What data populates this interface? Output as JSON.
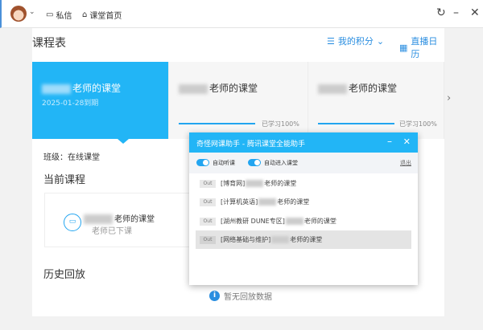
{
  "topbar": {
    "messages": "私信",
    "home": "课堂首页",
    "icons": [
      "avatar",
      "chevron-down-icon",
      "message-icon",
      "home-icon",
      "refresh-icon",
      "minimize-icon",
      "close-icon"
    ]
  },
  "main": {
    "title": "课程表",
    "points": "我的积分",
    "calendar": "直播日历",
    "cards": [
      {
        "name": "老师的课堂",
        "date": "2025-01-28到期",
        "active": true
      },
      {
        "name": "老师的课堂",
        "progress_label": "已学习100%",
        "progress": 100
      },
      {
        "name": "老师的课堂",
        "progress_label": "已学习100%",
        "progress": 100
      }
    ],
    "class_label": "班级：在线课堂",
    "current_title": "当前课程",
    "current_course": {
      "name": "老师的课堂",
      "status": "老师已下课"
    },
    "history_title": "历史回放",
    "no_history": "暂无回放数据"
  },
  "popup": {
    "title": "奇怪网课助手 - 腾讯课堂全能助手",
    "toggle1": "自动听课",
    "toggle2": "自动进入课堂",
    "exit": "退出",
    "out_label": "Out",
    "items": [
      {
        "prefix": "[博育网]",
        "suffix": "老师的课堂"
      },
      {
        "prefix": "[计算机英语]",
        "suffix": "老师的课堂"
      },
      {
        "prefix": "[湖州教研 DUNE专区]",
        "suffix": "老师的课堂"
      },
      {
        "prefix": "[网络基础与维护]",
        "suffix": "老师的课堂"
      }
    ]
  },
  "colors": {
    "accent": "#22b5f6",
    "link": "#2a8ee0",
    "warn": "#e07a4a"
  }
}
